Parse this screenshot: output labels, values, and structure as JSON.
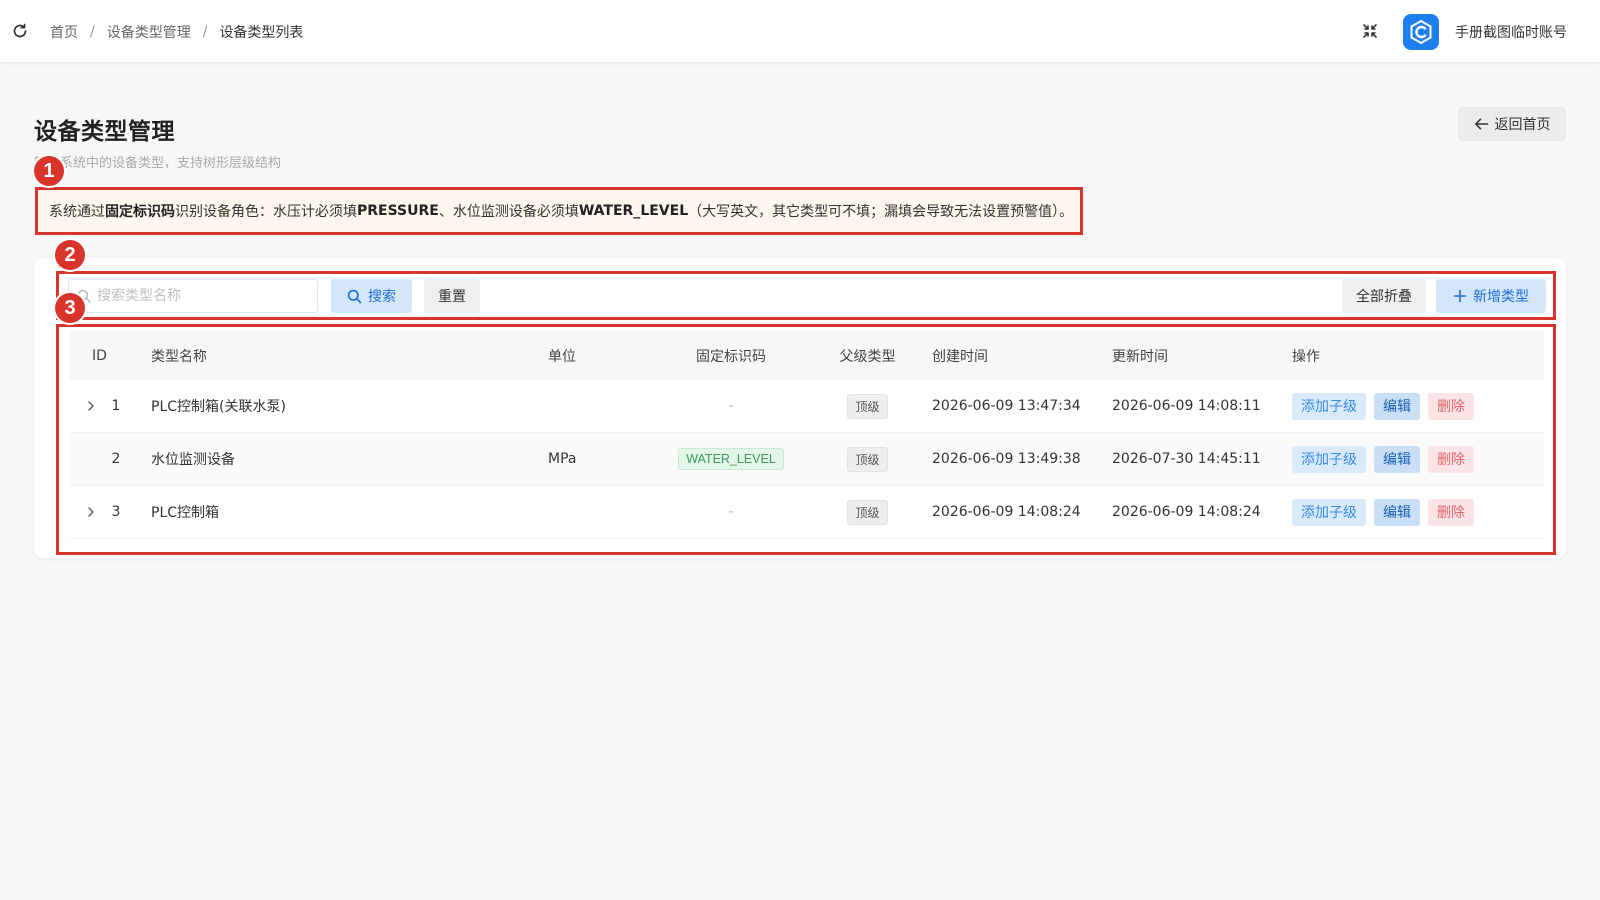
{
  "header": {
    "breadcrumb": [
      "首页",
      "设备类型管理",
      "设备类型列表"
    ],
    "separator": "/",
    "account_name": "手册截图临时账号",
    "icons": {
      "refresh": "refresh-icon",
      "fullscreen": "exit-fullscreen-icon",
      "logo": "app-logo"
    }
  },
  "page": {
    "title": "设备类型管理",
    "subtitle": "管理系统中的设备类型，支持树形层级结构",
    "back_label": "返回首页"
  },
  "notice": {
    "prefix": "系统通过",
    "bold1": "固定标识码",
    "mid1": "识别设备角色：水压计必须填 ",
    "bold2": "PRESSURE",
    "mid2": "、水位监测设备必须填 ",
    "bold3": "WATER_LEVEL",
    "suffix": "（大写英文，其它类型可不填；漏填会导致无法设置预警值）。"
  },
  "markers": [
    "1",
    "2",
    "3"
  ],
  "toolbar": {
    "search_placeholder": "搜索类型名称",
    "search_label": "搜索",
    "reset_label": "重置",
    "collapse_label": "全部折叠",
    "add_label": "新增类型"
  },
  "table": {
    "columns": [
      "ID",
      "类型名称",
      "单位",
      "固定标识码",
      "父级类型",
      "创建时间",
      "更新时间",
      "操作"
    ],
    "rows": [
      {
        "id": "1",
        "expandable": true,
        "name": "PLC控制箱(关联水泵)",
        "unit": "",
        "code": "-",
        "parent": "顶级",
        "created": "2026-06-09 13:47:34",
        "updated": "2026-06-09 14:08:11"
      },
      {
        "id": "2",
        "expandable": false,
        "name": "水位监测设备",
        "unit": "MPa",
        "code": "WATER_LEVEL",
        "parent": "顶级",
        "created": "2026-06-09 13:49:38",
        "updated": "2026-07-30 14:45:11"
      },
      {
        "id": "3",
        "expandable": true,
        "name": "PLC控制箱",
        "unit": "",
        "code": "-",
        "parent": "顶级",
        "created": "2026-06-09 14:08:24",
        "updated": "2026-06-09 14:08:24"
      }
    ],
    "actions": {
      "add_child": "添加子级",
      "edit": "编辑",
      "delete": "删除"
    }
  },
  "colors": {
    "primary": "#1f7ef0",
    "annotation_red": "#d8342b",
    "notice_bg": "#fdf6ec",
    "code_tag": "#3b9a58",
    "delete": "#e0646e"
  }
}
